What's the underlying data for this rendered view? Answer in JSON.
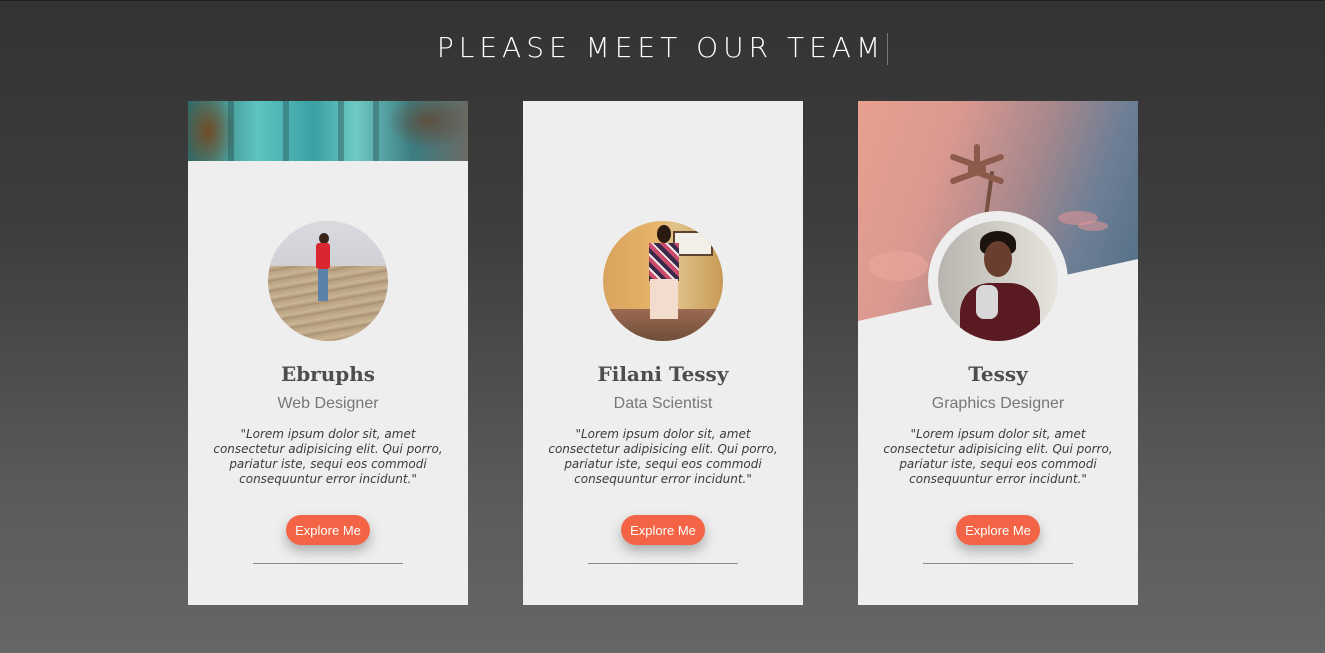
{
  "header": {
    "title": "PLEASE MEET OUR TEAM"
  },
  "team": [
    {
      "name": "Ebruphs",
      "role": "Web Designer",
      "quote": "\"Lorem ipsum dolor sit, amet consectetur adipisicing elit. Qui porro, pariatur iste, sequi eos commodi consequuntur error incidunt.\"",
      "button_label": "Explore Me"
    },
    {
      "name": "Filani Tessy",
      "role": "Data Scientist",
      "quote": "\"Lorem ipsum dolor sit, amet consectetur adipisicing elit. Qui porro, pariatur iste, sequi eos commodi consequuntur error incidunt.\"",
      "button_label": "Explore Me"
    },
    {
      "name": "Tessy",
      "role": "Graphics Designer",
      "quote": "\"Lorem ipsum dolor sit, amet consectetur adipisicing elit. Qui porro, pariatur iste, sequi eos commodi consequuntur error incidunt.\"",
      "button_label": "Explore Me"
    }
  ],
  "colors": {
    "accent": "#f26445",
    "card_bg": "#eeeeee",
    "name_text": "#4d4d4d",
    "role_text": "#777777"
  }
}
